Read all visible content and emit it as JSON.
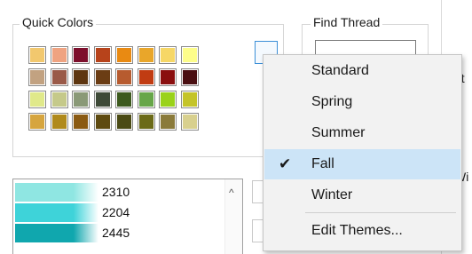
{
  "quick_colors": {
    "title": "Quick Colors",
    "swatches": [
      [
        "#f2c86e",
        "#efa381",
        "#7d0f2c",
        "#b7431b",
        "#e98a12",
        "#e9a62a",
        "#f6d766",
        "#fdfd8a"
      ],
      [
        "#c2a281",
        "#9a5a48",
        "#5e3610",
        "#6b3d14",
        "#b75b2f",
        "#c13c12",
        "#8a0e0e",
        "#4a0f12"
      ],
      [
        "#e0e98a",
        "#c5c98a",
        "#8a9977",
        "#3e4a38",
        "#3d5a1e",
        "#67a649",
        "#9ad21a",
        "#c4c429"
      ],
      [
        "#d6a53e",
        "#b08a1c",
        "#8a5a12",
        "#5e4a10",
        "#4a4a14",
        "#6b6a18",
        "#8a7a3a",
        "#d8d08e"
      ]
    ],
    "theme_button_icon": "chevron-down-icon",
    "theme_button_glyph": "⌄"
  },
  "find_thread": {
    "title": "Find Thread",
    "search_value": ""
  },
  "theme_menu": {
    "items": [
      {
        "label": "Standard",
        "checked": false
      },
      {
        "label": "Spring",
        "checked": false
      },
      {
        "label": "Summer",
        "checked": false
      },
      {
        "label": "Fall",
        "checked": true
      },
      {
        "label": "Winter",
        "checked": false
      }
    ],
    "edit_label": "Edit Themes...",
    "check_glyph": "✔"
  },
  "thread_list": {
    "rows": [
      {
        "code": "2310",
        "color": "#8fe6e2"
      },
      {
        "code": "2204",
        "color": "#3ed3d9"
      },
      {
        "code": "2445",
        "color": "#10a7ae"
      }
    ],
    "scroll_up_glyph": "^"
  },
  "right_fragments": [
    "ut",
    "Wi"
  ]
}
